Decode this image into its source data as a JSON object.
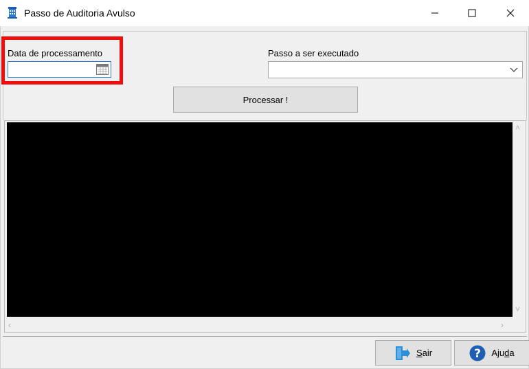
{
  "window": {
    "title": "Passo de Auditoria Avulso",
    "icon": "app-building-icon"
  },
  "form": {
    "date_label": "Data de processamento",
    "date_value": "",
    "step_label": "Passo a ser executado",
    "step_value": "",
    "process_button": "Processar !"
  },
  "output": {
    "text": ""
  },
  "footer": {
    "exit_prefix": "",
    "exit_mnemonic": "S",
    "exit_rest": "air",
    "help_prefix": "Aju",
    "help_mnemonic": "d",
    "help_rest": "a"
  },
  "colors": {
    "highlight": "#f20d0d",
    "output_bg": "#000000",
    "help_icon": "#1e5fb4",
    "exit_icon": "#2a8fd6"
  }
}
